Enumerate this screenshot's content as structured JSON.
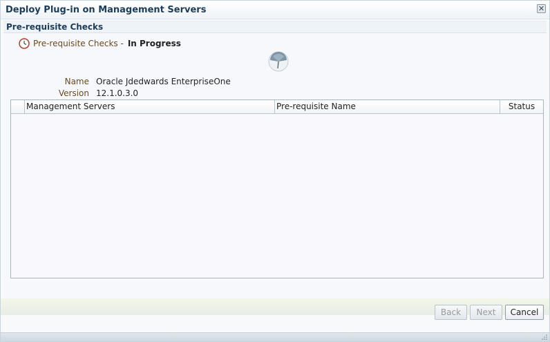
{
  "dialog": {
    "title": "Deploy Plug-in on Management Servers",
    "close_glyph": "✕"
  },
  "section": {
    "title": "Pre-requisite Checks"
  },
  "status": {
    "icon": "clock-icon",
    "label": "Pre-requisite Checks -",
    "value": "In Progress"
  },
  "properties": {
    "name_label": "Name",
    "name_value": "Oracle Jdedwards EnterpriseOne",
    "version_label": "Version",
    "version_value": "12.1.0.3.0"
  },
  "table": {
    "columns": [
      "",
      "Management Servers",
      "Pre-requisite Name",
      "Status"
    ],
    "rows": []
  },
  "buttons": {
    "back": "Back",
    "next": "Next",
    "cancel": "Cancel"
  },
  "colors": {
    "title": "#1c3c5a",
    "label": "#6b4a1e",
    "border": "#a9b6c2"
  }
}
